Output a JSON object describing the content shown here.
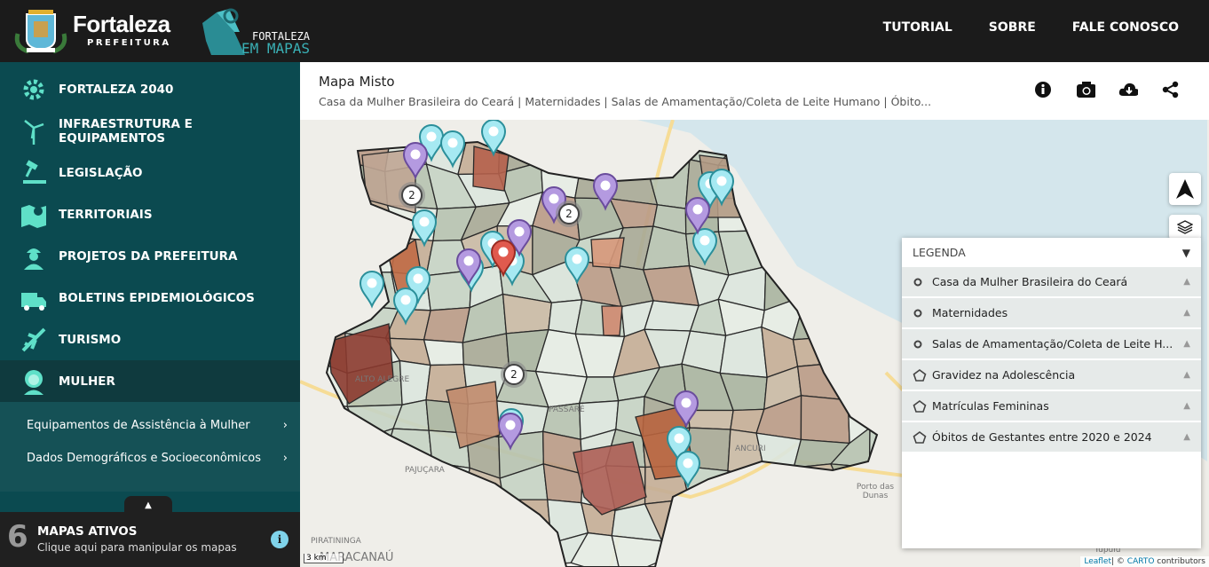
{
  "header": {
    "brand": "Fortaleza",
    "brand_sub": "PREFEITURA",
    "app_line1": "FORTALEZA",
    "app_line2": "EM MAPAS",
    "nav": [
      "TUTORIAL",
      "SOBRE",
      "FALE CONOSCO"
    ]
  },
  "sidebar": {
    "items": [
      {
        "label": "FORTALEZA 2040",
        "icon": "gear-icon"
      },
      {
        "label": "INFRAESTRUTURA E EQUIPAMENTOS",
        "icon": "wind-turbine-icon"
      },
      {
        "label": "LEGISLAÇÃO",
        "icon": "gavel-icon"
      },
      {
        "label": "TERRITORIAIS",
        "icon": "map-icon"
      },
      {
        "label": "PROJETOS DA PREFEITURA",
        "icon": "worker-icon"
      },
      {
        "label": "BOLETINS EPIDEMIOLÓGICOS",
        "icon": "ambulance-icon"
      },
      {
        "label": "TURISMO",
        "icon": "airplane-icon"
      },
      {
        "label": "MULHER",
        "icon": "woman-icon"
      }
    ],
    "submenu": [
      "Equipamentos de Assistência à Mulher",
      "Dados Demográficos e Socioeconômicos"
    ]
  },
  "active_maps": {
    "count": "6",
    "title": "MAPAS ATIVOS",
    "subtitle": "Clique aqui para manipular os mapas"
  },
  "map_header": {
    "title": "Mapa Misto",
    "subtitle": "Casa da Mulher Brasileira do Ceará | Maternidades | Salas de Amamentação/Coleta de Leite Humano | Óbito..."
  },
  "legend": {
    "title": "LEGENDA",
    "items": [
      {
        "label": "Casa da Mulher Brasileira do Ceará",
        "type": "point"
      },
      {
        "label": "Maternidades",
        "type": "point"
      },
      {
        "label": "Salas de Amamentação/Coleta de Leite H...",
        "type": "point"
      },
      {
        "label": "Gravidez na Adolescência",
        "type": "polygon"
      },
      {
        "label": "Matrículas Femininas",
        "type": "polygon"
      },
      {
        "label": "Óbitos de Gestantes entre 2020 e 2024",
        "type": "polygon"
      }
    ]
  },
  "map": {
    "clusters": [
      "2",
      "2",
      "2"
    ],
    "places": [
      "ALTO ALEGRE",
      "PAJUÇARA",
      "PIRATININGA",
      "MARACANAÚ",
      "Porto das Dunas",
      "Tupuiú",
      "ANCURI",
      "PASSARÉ"
    ],
    "scale": "3 km",
    "attribution_leaflet": "Leaflet",
    "attribution_rest": "| © ",
    "attribution_carto": "CARTO",
    "attribution_end": " contributors",
    "colors": {
      "cyan_pin": "#a6e9f2",
      "purple_pin": "#b49ae0",
      "red_pin": "#e05a4e"
    }
  }
}
